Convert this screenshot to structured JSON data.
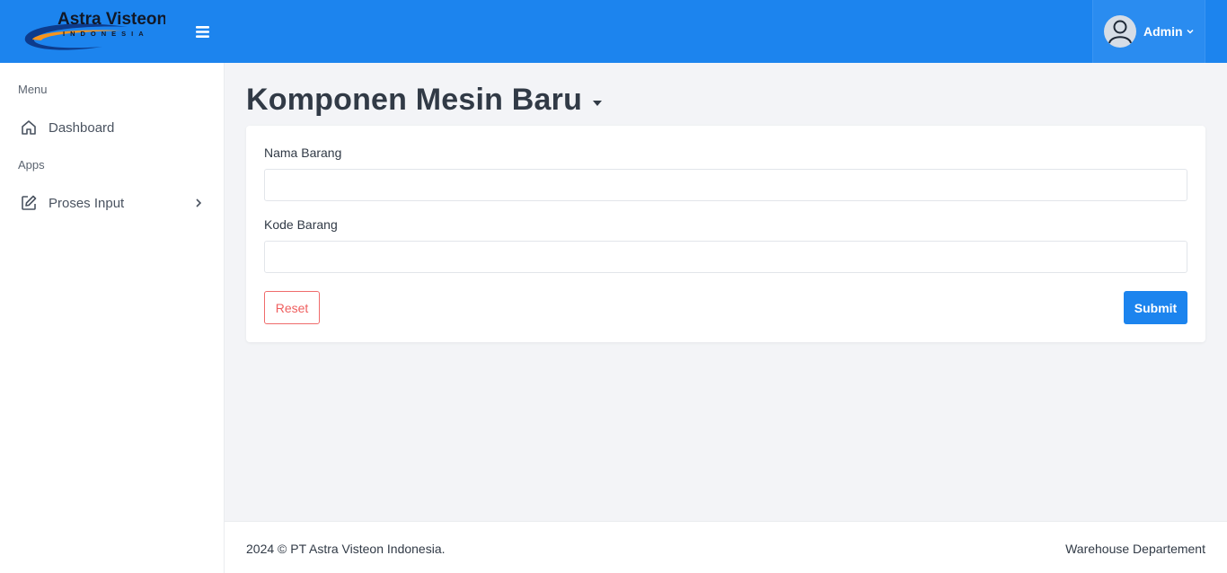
{
  "brand": {
    "name": "Astra Visteon",
    "sub": "INDONESIA"
  },
  "header": {
    "user_name": "Admin"
  },
  "sidebar": {
    "sections": [
      {
        "title": "Menu",
        "items": [
          {
            "label": "Dashboard",
            "icon": "home-icon"
          }
        ]
      },
      {
        "title": "Apps",
        "items": [
          {
            "label": "Proses Input",
            "icon": "edit-icon"
          }
        ]
      }
    ]
  },
  "page": {
    "title": "Komponen Mesin Baru"
  },
  "form": {
    "fields": [
      {
        "label": "Nama Barang",
        "value": ""
      },
      {
        "label": "Kode Barang",
        "value": ""
      }
    ],
    "reset_label": "Reset",
    "submit_label": "Submit"
  },
  "footer": {
    "left": "2024 © PT Astra Visteon Indonesia.",
    "right": "Warehouse Departement"
  },
  "colors": {
    "primary": "#1c84ee",
    "danger": "#ef5f5f",
    "background": "#f3f4f7"
  }
}
